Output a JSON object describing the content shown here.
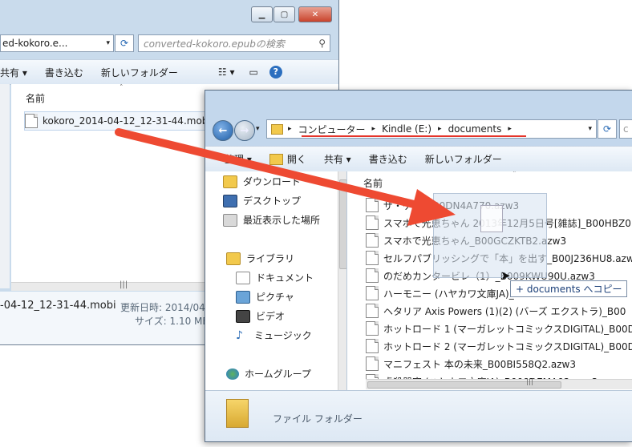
{
  "back_window": {
    "address_text": "ed-kokoro.e...",
    "search_placeholder": "converted-kokoro.epubの検索",
    "toolbar": {
      "share": "共有 ▾",
      "burn": "書き込む",
      "new_folder": "新しいフォルダー"
    },
    "column_name": "名前",
    "file_name": "kokoro_2014-04-12_12-31-44.mobi",
    "details": {
      "file_name": "-04-12_12-31-44.mobi",
      "updated_label": "更新日時: 2014/04",
      "size_label": "サイズ: 1.10 MB"
    }
  },
  "front_window": {
    "breadcrumb": [
      "コンピューター",
      "Kindle (E:)",
      "documents"
    ],
    "toolbar": {
      "organize": "整理 ▾",
      "open": "開く",
      "share": "共有 ▾",
      "burn": "書き込む",
      "new_folder": "新しいフォルダー"
    },
    "column_name": "名前",
    "nav_items": [
      {
        "label": "ダウンロード",
        "icon": "download-folder-icon"
      },
      {
        "label": "デスクトップ",
        "icon": "desktop-icon"
      },
      {
        "label": "最近表示した場所",
        "icon": "recent-places-icon"
      },
      {
        "label": "ライブラリ",
        "icon": "library-icon"
      },
      {
        "label": "ドキュメント",
        "icon": "documents-icon"
      },
      {
        "label": "ピクチャ",
        "icon": "pictures-icon"
      },
      {
        "label": "ビデオ",
        "icon": "video-icon"
      },
      {
        "label": "ミュージック",
        "icon": "music-icon"
      },
      {
        "label": "ホームグループ",
        "icon": "homegroup-icon"
      }
    ],
    "files": [
      "ザ・ゲイ_B00DN4A770.azw3",
      "スマホで光恵ちゃん 2013年12月5日号[雑誌]_B00HBZ0L",
      "スマホで光恵ちゃん_B00GCZKTB2.azw3",
      "セルフパブリッシングで「本」を出す_B00J236HU8.azw3",
      "のだめカンタービレ（1）_B009KWU90U.azw3",
      "ハーモニー (ハヤカワ文庫JA)_B00",
      "ヘタリア Axis Powers (1)(2) (バーズ エクストラ)_B00",
      "ホットロード 1 (マーガレットコミックスDIGITAL)_B00D",
      "ホットロード 2 (マーガレットコミックスDIGITAL)_B00D",
      "マニフェスト 本の未来_B00BI558Q2.azw3",
      "虐殺器官 (ハヤカワ文庫JA)_B009DEMA02.azw3"
    ],
    "drag_tooltip": "+ documents へコピー",
    "details_pane": {
      "type_label": "ファイル フォルダー"
    }
  },
  "colors": {
    "arrow": "#ee4a32",
    "underline": "#e5342a",
    "window_frame": "#c3d7ec",
    "toolbar": "#e4edf7"
  }
}
